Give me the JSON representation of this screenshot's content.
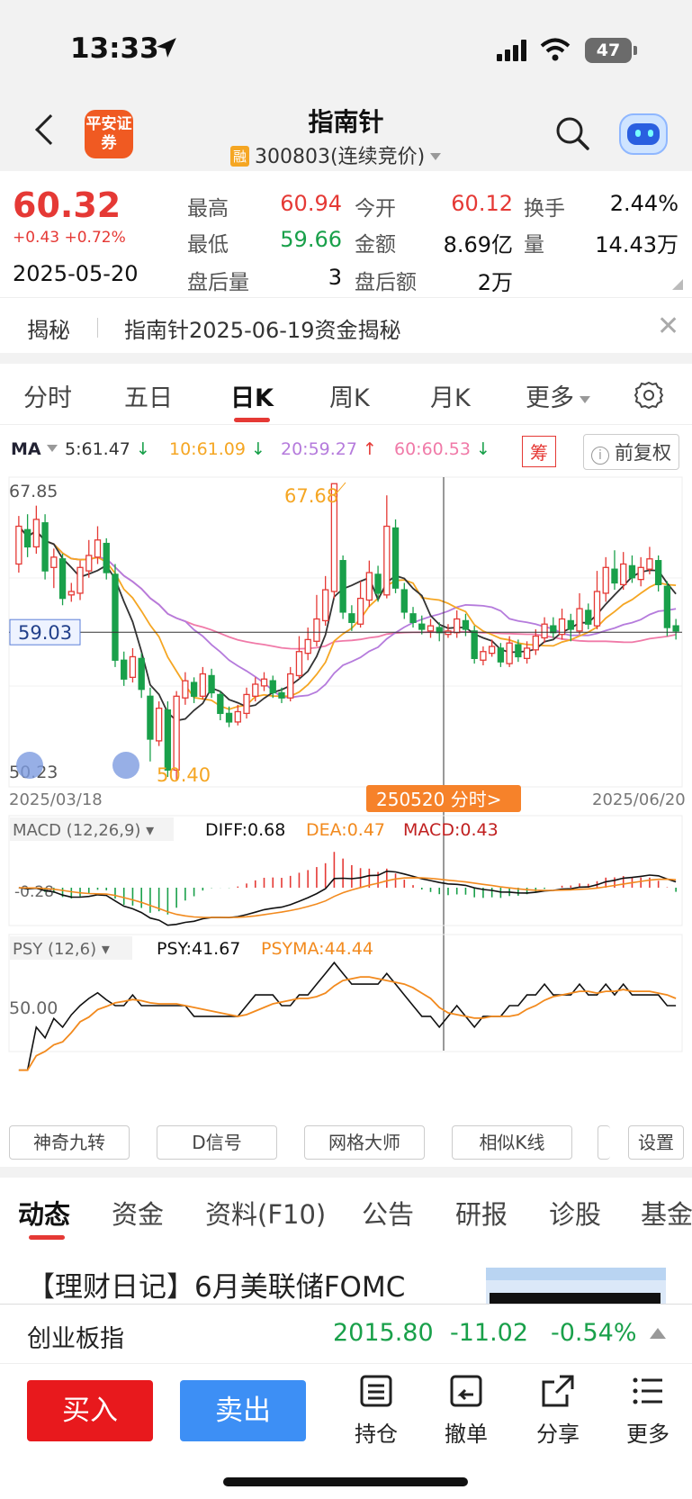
{
  "status_bar": {
    "time": "13:33",
    "battery": "47"
  },
  "header": {
    "title": "指南针",
    "subtitle_badge": "融",
    "subtitle": "300803(连续竞价)",
    "broker_logo": "平安证券"
  },
  "quote": {
    "price": "60.32",
    "change": "+0.43  +0.72%",
    "date": "2025-05-20",
    "fields": [
      {
        "label": "最高",
        "value": "60.94",
        "color": "red"
      },
      {
        "label": "今开",
        "value": "60.12",
        "color": "red"
      },
      {
        "label": "换手",
        "value": "2.44%",
        "color": "black"
      },
      {
        "label": "最低",
        "value": "59.66",
        "color": "green"
      },
      {
        "label": "金额",
        "value": "8.69亿",
        "color": "black"
      },
      {
        "label": "量",
        "value": "14.43万",
        "color": "black"
      },
      {
        "label": "盘后量",
        "value": "3",
        "color": "black"
      },
      {
        "label": "盘后额",
        "value": "2万",
        "color": "black"
      }
    ]
  },
  "reveal": {
    "label": "揭秘",
    "text": "指南针2025-06-19资金揭秘"
  },
  "period_tabs": [
    "分时",
    "五日",
    "日K",
    "周K",
    "月K",
    "更多"
  ],
  "ma_legend": {
    "name": "MA",
    "ma5": "5:61.47",
    "ma10": "10:61.09",
    "ma20": "20:59.27",
    "ma60": "60:60.53",
    "chip": "筹",
    "adjust": "前复权"
  },
  "chart_data": {
    "type": "candlestick",
    "price_labels": {
      "top": "67.85",
      "bottom": "50.23",
      "crosshair": "59.03",
      "high": "67.68",
      "low": "50.40"
    },
    "x_start": "2025/03/18",
    "x_end": "2025/06/20",
    "cursor_label": "250520 分时>",
    "ylim": [
      50.23,
      67.85
    ],
    "candles": [
      [
        63.0,
        65.2,
        65.8,
        62.5
      ],
      [
        65.0,
        64.0,
        65.9,
        63.4
      ],
      [
        64.0,
        65.6,
        66.4,
        63.6
      ],
      [
        65.4,
        62.6,
        65.9,
        62.1
      ],
      [
        62.8,
        63.4,
        63.9,
        61.6
      ],
      [
        63.3,
        61.0,
        63.6,
        60.6
      ],
      [
        61.2,
        61.4,
        61.9,
        60.8
      ],
      [
        61.3,
        62.8,
        63.2,
        60.9
      ],
      [
        62.6,
        63.5,
        64.4,
        62.2
      ],
      [
        63.4,
        64.4,
        65.2,
        63.0
      ],
      [
        64.2,
        62.5,
        64.5,
        62.1
      ],
      [
        62.4,
        57.4,
        63.0,
        57.0
      ],
      [
        57.4,
        56.3,
        57.9,
        55.9
      ],
      [
        56.4,
        57.6,
        58.1,
        56.1
      ],
      [
        57.5,
        55.7,
        57.8,
        55.2
      ],
      [
        55.3,
        52.8,
        55.8,
        51.5
      ],
      [
        52.7,
        54.6,
        55.0,
        52.4
      ],
      [
        54.5,
        51.0,
        55.0,
        50.6
      ],
      [
        51.0,
        55.3,
        55.6,
        50.4
      ],
      [
        55.2,
        56.2,
        56.7,
        54.8
      ],
      [
        56.1,
        55.3,
        56.4,
        54.9
      ],
      [
        55.3,
        56.6,
        57.0,
        55.1
      ],
      [
        56.5,
        55.5,
        56.9,
        55.2
      ],
      [
        55.4,
        54.3,
        55.6,
        53.9
      ],
      [
        54.3,
        53.8,
        54.7,
        53.5
      ],
      [
        53.8,
        54.4,
        54.8,
        53.6
      ],
      [
        54.3,
        55.4,
        55.8,
        54.0
      ],
      [
        55.3,
        56.0,
        56.4,
        55.0
      ],
      [
        55.9,
        56.3,
        56.7,
        55.6
      ],
      [
        56.2,
        55.5,
        56.5,
        55.2
      ],
      [
        55.5,
        55.2,
        55.8,
        54.9
      ],
      [
        55.2,
        56.6,
        57.0,
        55.0
      ],
      [
        56.5,
        57.9,
        58.8,
        56.3
      ],
      [
        57.8,
        58.6,
        59.3,
        57.4
      ],
      [
        58.5,
        59.8,
        61.2,
        58.2
      ],
      [
        59.7,
        61.5,
        62.3,
        59.4
      ],
      [
        61.4,
        67.68,
        67.68,
        61.0
      ],
      [
        63.2,
        60.2,
        63.5,
        59.8
      ],
      [
        60.1,
        59.6,
        60.6,
        59.1
      ],
      [
        59.5,
        61.0,
        62.0,
        59.3
      ],
      [
        60.9,
        62.5,
        63.2,
        60.5
      ],
      [
        62.4,
        61.3,
        62.9,
        60.8
      ],
      [
        61.2,
        65.2,
        67.0,
        61.0
      ],
      [
        65.1,
        61.6,
        65.6,
        61.3
      ],
      [
        61.5,
        60.2,
        61.9,
        59.8
      ],
      [
        60.1,
        59.6,
        60.5,
        59.3
      ],
      [
        59.5,
        59.2,
        60.0,
        58.9
      ],
      [
        59.1,
        59.4,
        59.8,
        58.7
      ],
      [
        59.3,
        59.0,
        59.6,
        58.5
      ],
      [
        58.9,
        59.1,
        59.5,
        58.7
      ],
      [
        59.0,
        59.8,
        60.3,
        58.7
      ],
      [
        59.7,
        59.2,
        60.1,
        58.8
      ],
      [
        59.1,
        57.5,
        59.4,
        57.2
      ],
      [
        57.4,
        57.9,
        58.2,
        57.1
      ],
      [
        57.8,
        58.2,
        58.6,
        57.6
      ],
      [
        58.1,
        57.3,
        58.4,
        57.0
      ],
      [
        57.2,
        58.4,
        58.8,
        57.0
      ],
      [
        58.3,
        57.6,
        58.6,
        57.3
      ],
      [
        57.5,
        58.1,
        58.5,
        57.2
      ],
      [
        58.0,
        58.8,
        59.2,
        57.7
      ],
      [
        58.7,
        59.5,
        59.9,
        58.4
      ],
      [
        59.4,
        59.0,
        59.9,
        58.7
      ],
      [
        58.9,
        59.8,
        60.4,
        58.6
      ],
      [
        59.7,
        59.2,
        60.1,
        58.5
      ],
      [
        59.1,
        60.4,
        61.3,
        58.9
      ],
      [
        60.3,
        59.5,
        60.7,
        59.2
      ],
      [
        59.4,
        61.4,
        62.6,
        59.2
      ],
      [
        61.3,
        62.8,
        63.4,
        60.8
      ],
      [
        62.7,
        61.9,
        63.8,
        61.5
      ],
      [
        61.8,
        63.0,
        63.7,
        61.5
      ],
      [
        62.9,
        62.2,
        63.5,
        61.9
      ],
      [
        62.1,
        62.8,
        63.4,
        61.7
      ],
      [
        62.7,
        63.3,
        64.0,
        62.4
      ],
      [
        63.2,
        61.8,
        63.5,
        61.4
      ],
      [
        61.7,
        59.3,
        62.0,
        58.8
      ],
      [
        59.4,
        59.1,
        59.8,
        58.6
      ]
    ],
    "macd": {
      "label": "MACD (12,26,9)",
      "diff": "DIFF:0.68",
      "dea": "DEA:0.47",
      "macd": "MACD:0.43",
      "ref": "-0.28"
    },
    "psy": {
      "label": "PSY (12,6)",
      "psy": "PSY:41.67",
      "psyma": "PSYMA:44.44",
      "ref": "50.00"
    }
  },
  "toolbar": [
    "神奇九转",
    "D信号",
    "网格大师",
    "相似K线",
    "",
    "设置"
  ],
  "news_tabs": [
    "动态",
    "资金",
    "资料(F10)",
    "公告",
    "研报",
    "诊股",
    "基金"
  ],
  "article": "【理财日记】6月美联储FOMC",
  "index_bar": {
    "name": "创业板指",
    "value": "2015.80",
    "change": "-11.02",
    "pct": "-0.54%"
  },
  "bottom_bar": {
    "buy": "买入",
    "sell": "卖出",
    "actions": [
      "持仓",
      "撤单",
      "分享",
      "更多"
    ]
  },
  "colors": {
    "up": "#e53935",
    "down": "#19a04a",
    "ma5": "#333333",
    "ma10": "#f5a623",
    "ma20": "#b57bdc",
    "ma60": "#f07aa8",
    "macd_dea": "#f28a1e",
    "psyma": "#f28a1e",
    "accent": "#f6822a"
  }
}
